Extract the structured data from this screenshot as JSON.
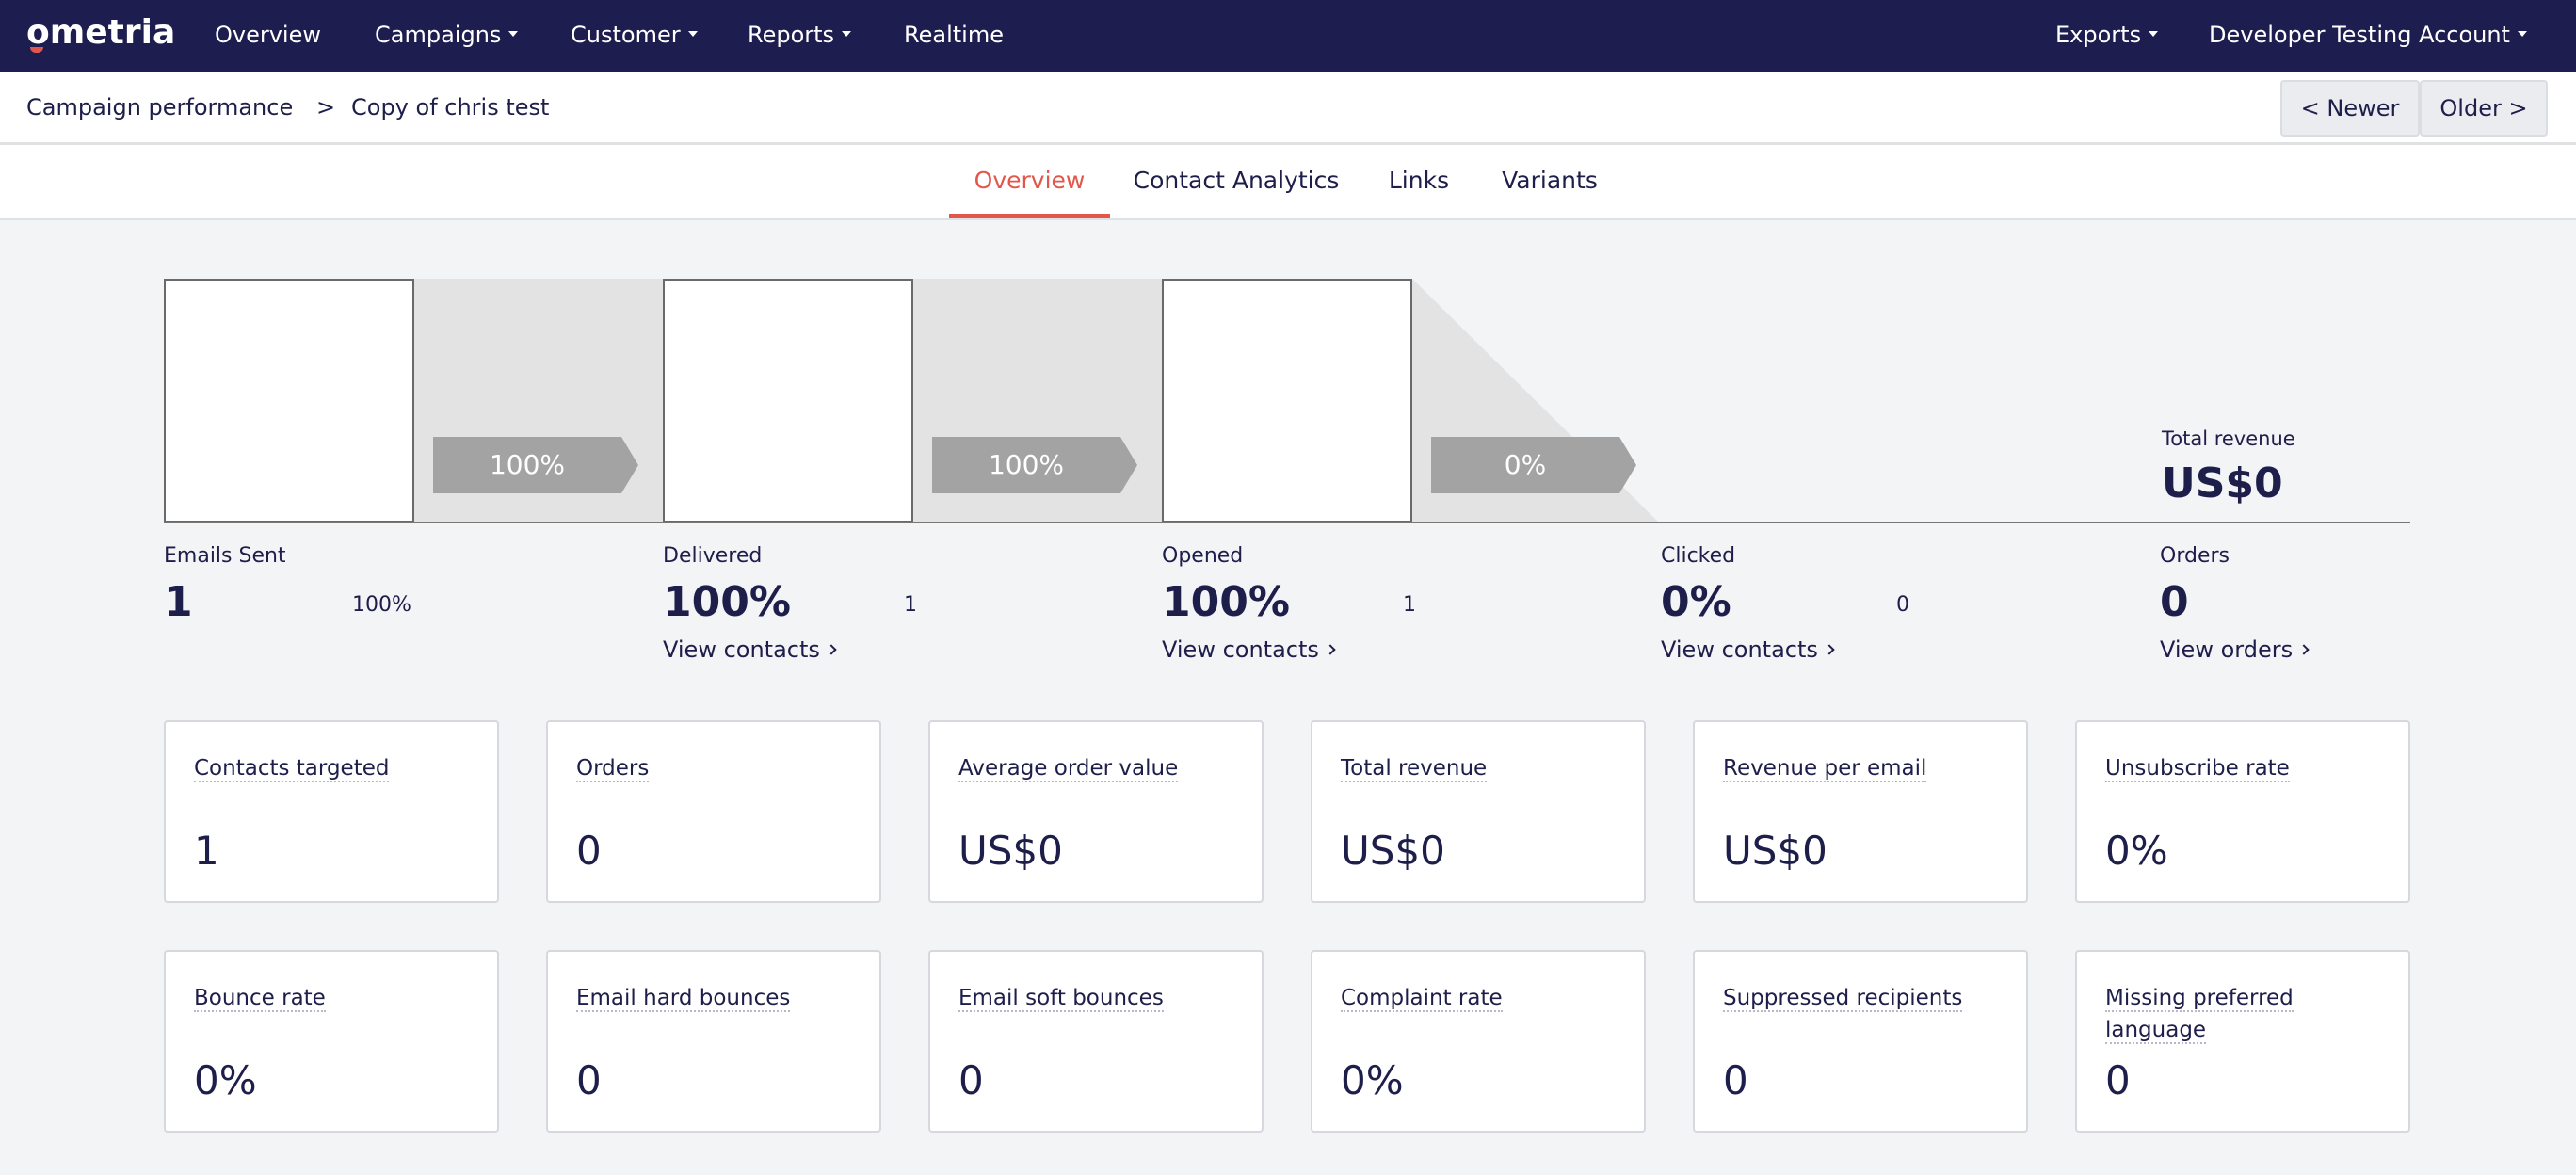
{
  "topnav": {
    "logo": "ometria",
    "items": [
      "Overview",
      "Campaigns",
      "Customer",
      "Reports",
      "Realtime"
    ],
    "exports": "Exports",
    "account": "Developer Testing Account"
  },
  "breadcrumb": {
    "parent": "Campaign performance",
    "separator": ">",
    "current": "Copy of chris test"
  },
  "pager": {
    "newer": "< Newer",
    "older": "Older >"
  },
  "tabs": [
    "Overview",
    "Contact Analytics",
    "Links",
    "Variants"
  ],
  "funnel": {
    "arrows": [
      "100%",
      "100%",
      "0%"
    ],
    "total_revenue_label": "Total revenue",
    "total_revenue_value": "US$0"
  },
  "stages": {
    "sent": {
      "label": "Emails Sent",
      "value": "1",
      "pct": "100%"
    },
    "delivered": {
      "label": "Delivered",
      "value": "100%",
      "count": "1",
      "link": "View contacts"
    },
    "opened": {
      "label": "Opened",
      "value": "100%",
      "count": "1",
      "link": "View contacts"
    },
    "clicked": {
      "label": "Clicked",
      "value": "0%",
      "count": "0",
      "link": "View contacts"
    },
    "orders": {
      "label": "Orders",
      "value": "0",
      "link": "View orders"
    }
  },
  "cards": [
    {
      "title": "Contacts targeted",
      "value": "1"
    },
    {
      "title": "Orders",
      "value": "0"
    },
    {
      "title": "Average order value",
      "value": "US$0"
    },
    {
      "title": "Total revenue",
      "value": "US$0"
    },
    {
      "title": "Revenue per email",
      "value": "US$0"
    },
    {
      "title": "Unsubscribe rate",
      "value": "0%"
    },
    {
      "title": "Bounce rate",
      "value": "0%"
    },
    {
      "title": "Email hard bounces",
      "value": "0"
    },
    {
      "title": "Email soft bounces",
      "value": "0"
    },
    {
      "title": "Complaint rate",
      "value": "0%"
    },
    {
      "title": "Suppressed recipients",
      "value": "0"
    },
    {
      "title": "Missing preferred language",
      "value": "0"
    }
  ],
  "colors": {
    "nav_bg": "#1e1d4f",
    "accent": "#e2574c",
    "text": "#1e1e4b",
    "page_bg": "#f3f4f6",
    "funnel_gap": "#e3e3e3",
    "arrow": "#a3a3a3"
  }
}
